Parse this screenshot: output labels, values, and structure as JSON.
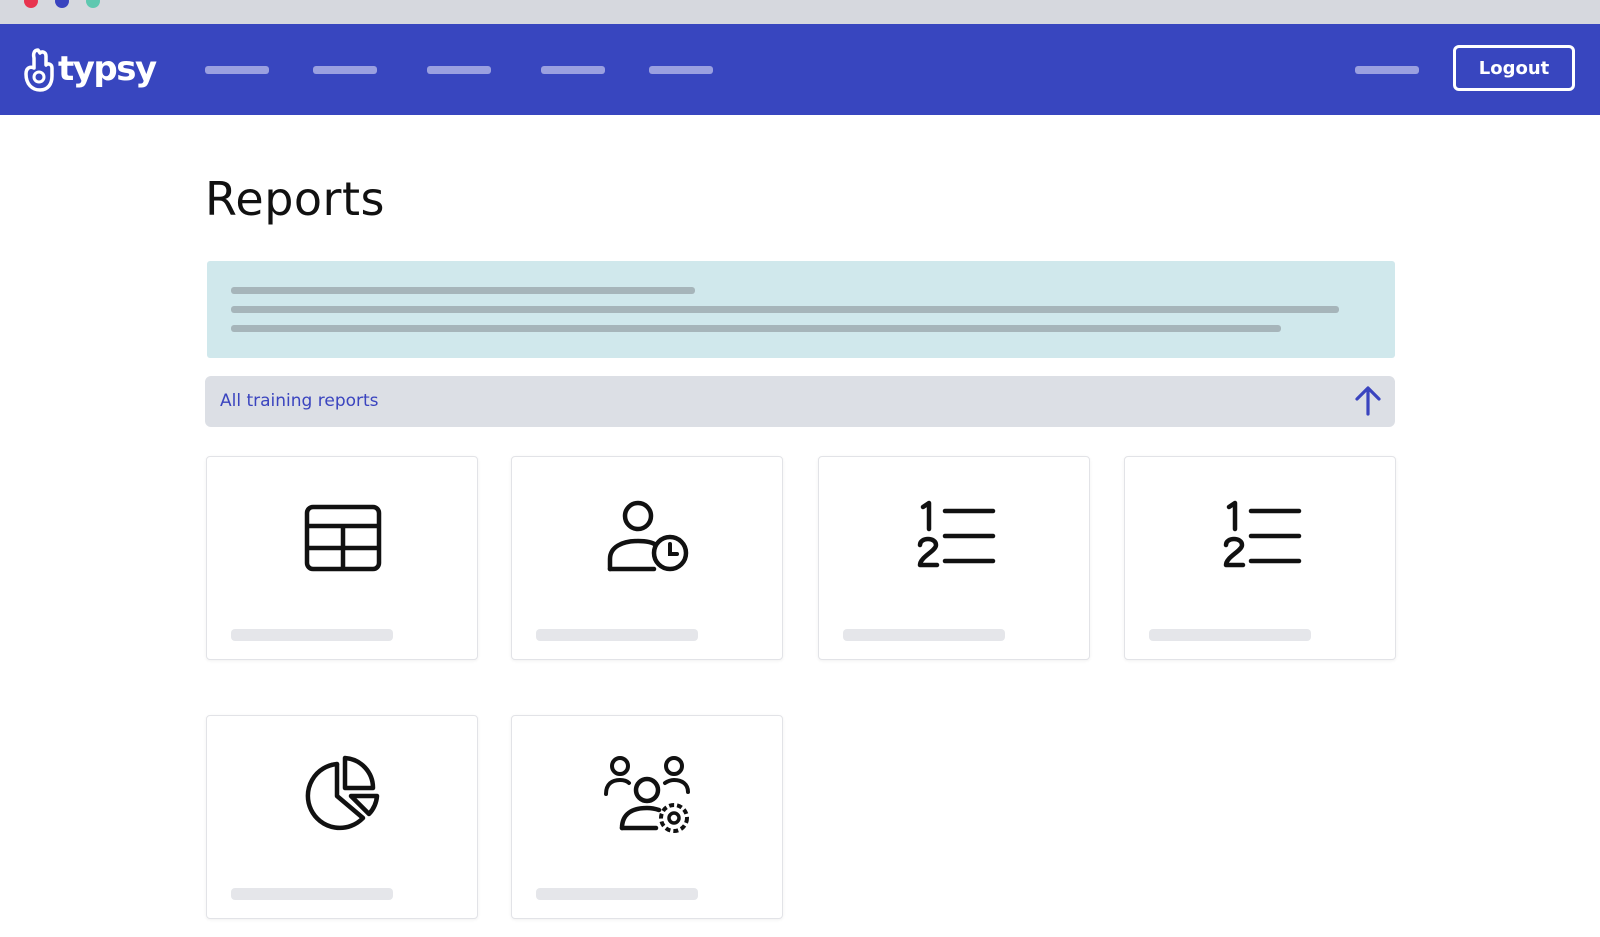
{
  "window": {
    "controls": [
      "close-dot",
      "minimize-dot",
      "maximize-dot"
    ],
    "colors": {
      "close": "#e8344f",
      "minimize": "#3a44bf",
      "maximize": "#5fc8b0"
    }
  },
  "header": {
    "brand": "typsy",
    "logo_icon": "typsy-hand-logo",
    "nav_item_count_visible_as_placeholders": 5,
    "logout_label": "Logout",
    "background_color": "#3846bf"
  },
  "main": {
    "title": "Reports",
    "banner_color": "#d0e8ec",
    "section": {
      "label": "All training reports",
      "toggle_icon": "arrow-up-icon",
      "expanded": true
    },
    "report_cards": [
      {
        "icon": "table-icon"
      },
      {
        "icon": "user-clock-icon"
      },
      {
        "icon": "numbered-list-icon"
      },
      {
        "icon": "numbered-list-icon"
      },
      {
        "icon": "pie-chart-icon"
      },
      {
        "icon": "users-gear-icon"
      }
    ]
  }
}
